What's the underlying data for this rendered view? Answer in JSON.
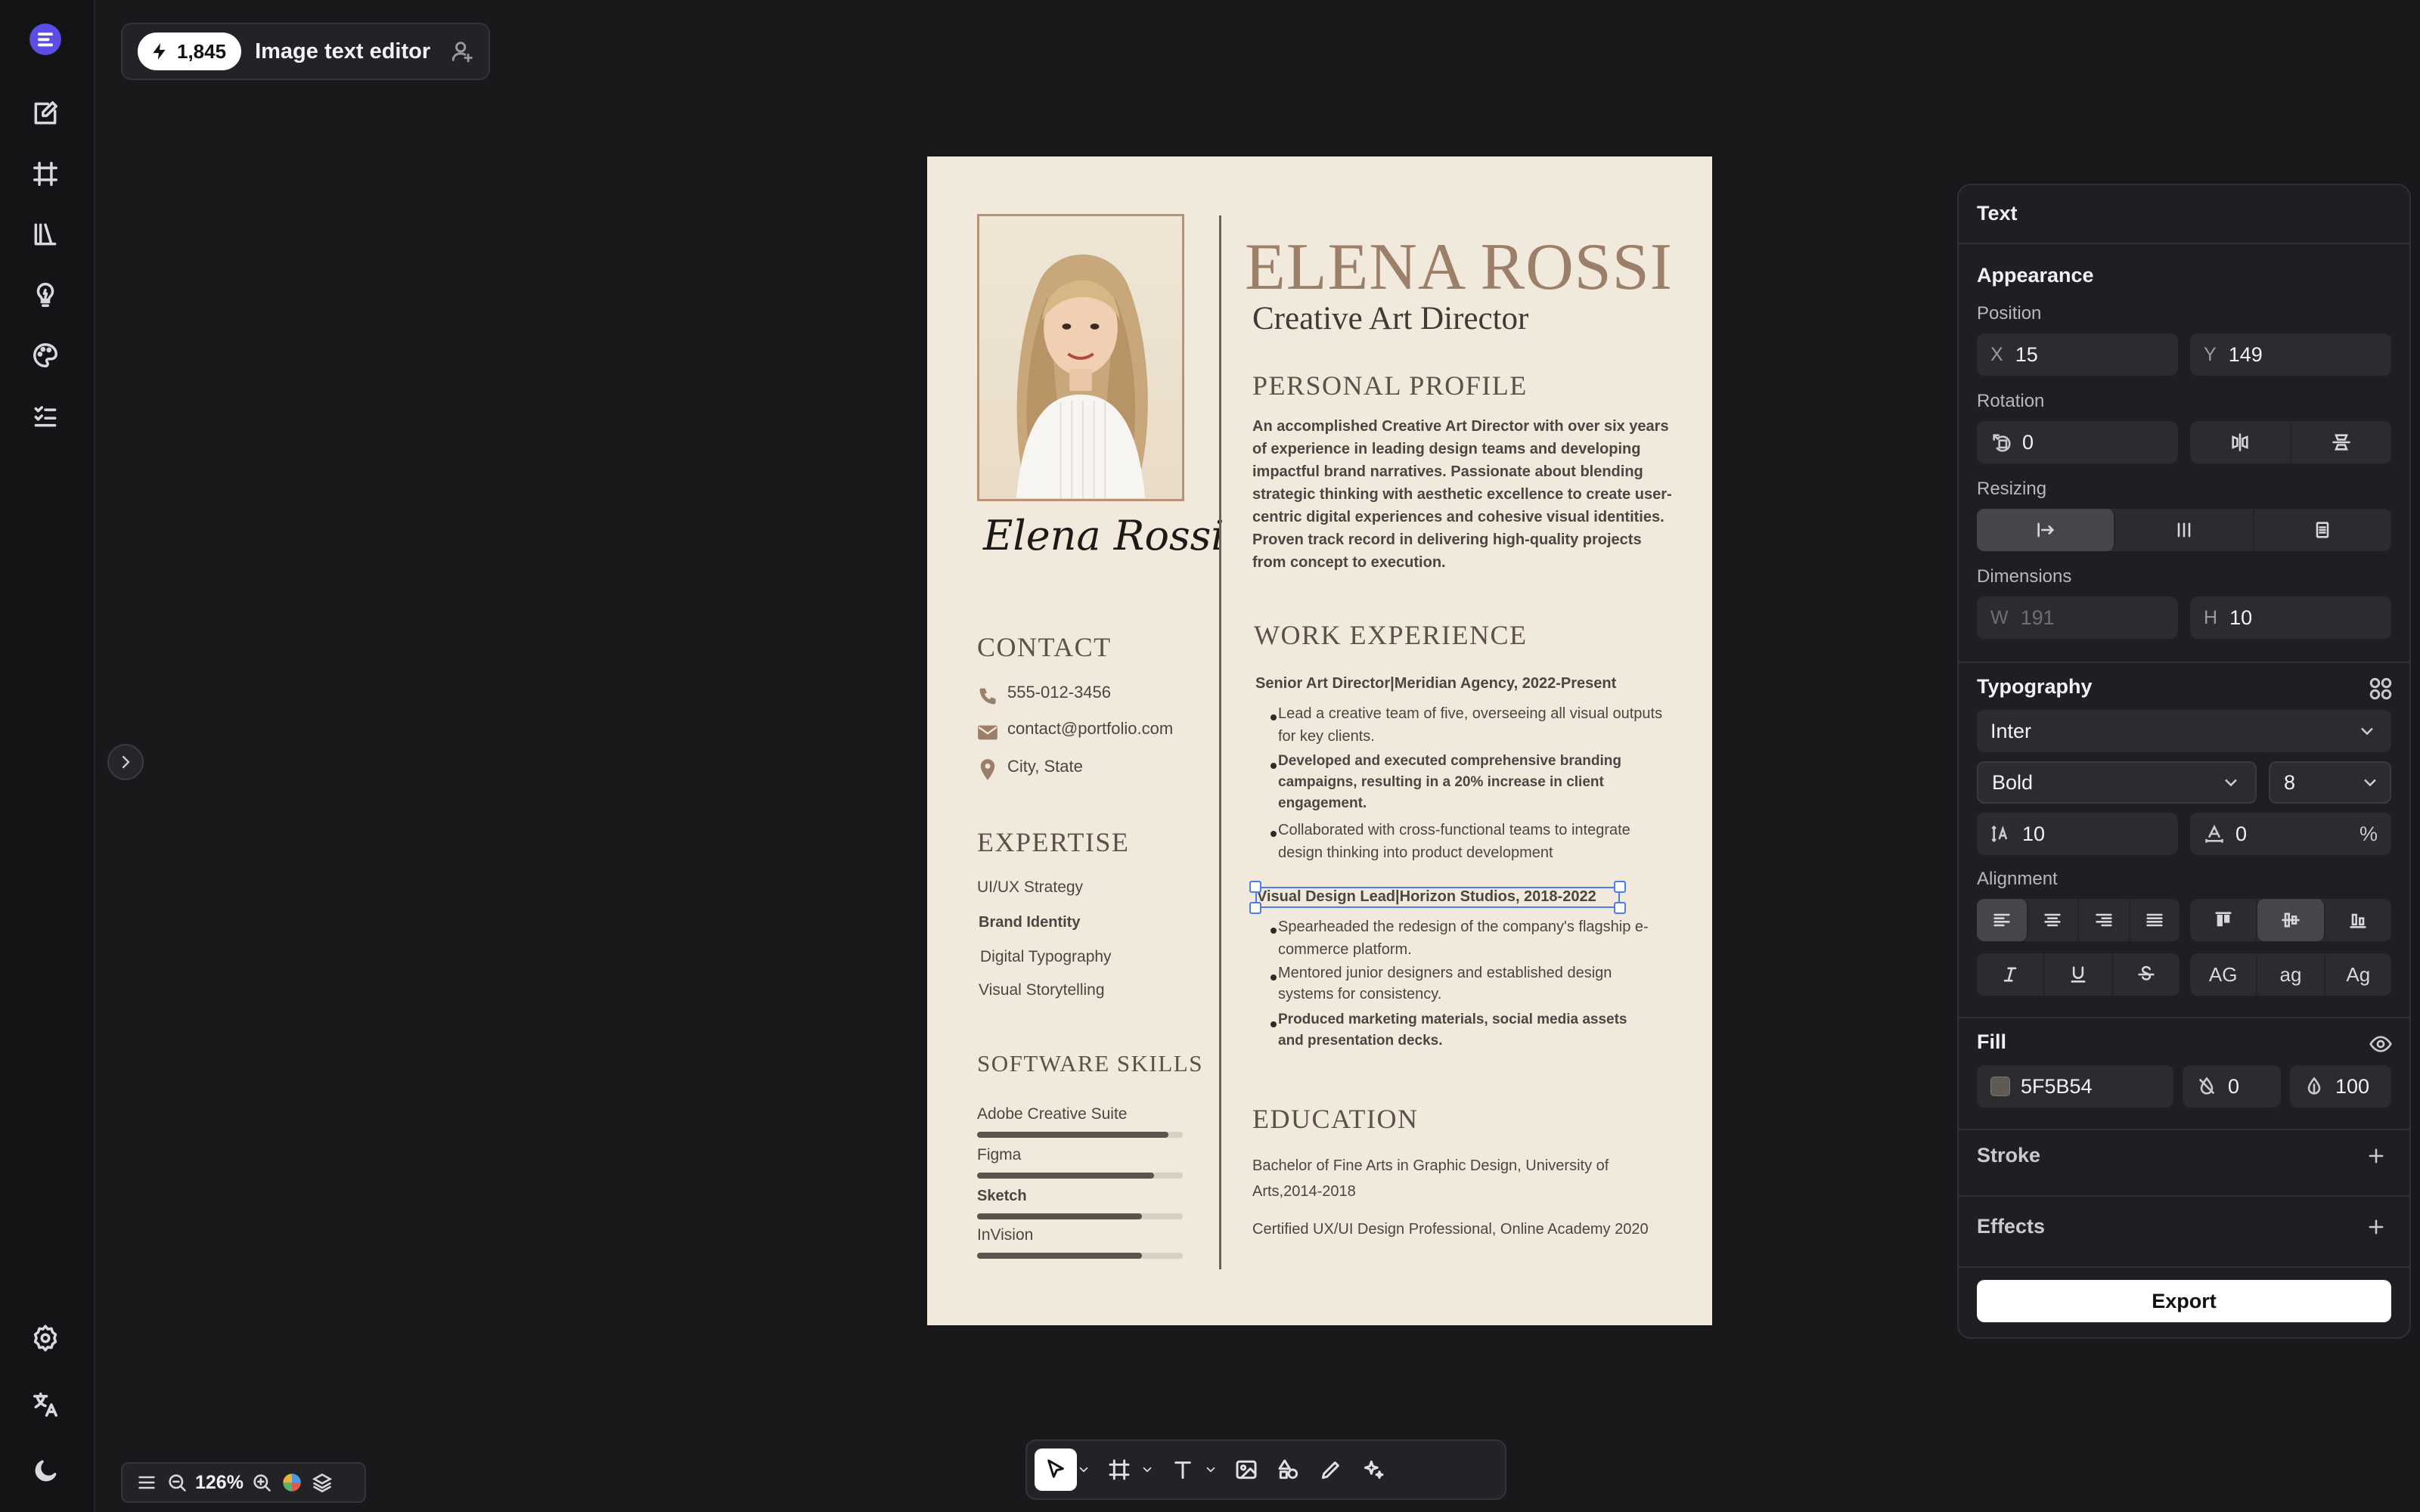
{
  "app": {
    "credits": "1,845",
    "title": "Image text editor",
    "zoom": "126%"
  },
  "doc": {
    "name": "ELENA ROSSI",
    "role": "Creative Art Director",
    "signature": "Elena Rossi",
    "profile_heading": "PERSONAL PROFILE",
    "profile_text": "An accomplished Creative Art Director with over six years of experience in leading design teams and developing impactful brand narratives. Passionate about blending strategic thinking with aesthetic excellence to create user-centric digital experiences and cohesive visual identities. Proven track record in delivering high-quality projects from concept to execution.",
    "contact_heading": "CONTACT",
    "phone": "555-012-3456",
    "email": "contact@portfolio.com",
    "location": "City, State",
    "expertise_heading": "EXPERTISE",
    "expertise": [
      "UI/UX Strategy",
      "Brand Identity",
      "Digital Typography",
      "Visual Storytelling"
    ],
    "software_heading": "SOFTWARE SKILLS",
    "software": [
      {
        "name": "Adobe Creative Suite",
        "level": 0.93
      },
      {
        "name": "Figma",
        "level": 0.86
      },
      {
        "name": "Sketch",
        "level": 0.8
      },
      {
        "name": "InVision",
        "level": 0.8
      }
    ],
    "work_heading": "WORK EXPERIENCE",
    "job1_title": "Senior Art Director|Meridian Agency, 2022-Present",
    "job1_b1": "Lead a creative team of five, overseeing all visual outputs for key clients.",
    "job1_b2": "Developed and executed comprehensive branding campaigns, resulting in a 20% increase in client engagement.",
    "job1_b3": "Collaborated with cross-functional teams to integrate design thinking into product development",
    "job2_title": "Visual Design Lead|Horizon Studios, 2018-2022",
    "job2_b1": "Spearheaded the redesign of the company's flagship e-commerce platform.",
    "job2_b2": "Mentored junior designers and established design systems for consistency.",
    "job2_b3": "Produced marketing materials, social media assets and presentation decks.",
    "education_heading": "EDUCATION",
    "edu1": "Bachelor of Fine Arts in Graphic Design, University of Arts,2014-2018",
    "edu2": "Certified UX/UI Design Professional, Online Academy 2020"
  },
  "panel": {
    "title": "Text",
    "appearance": "Appearance",
    "position_label": "Position",
    "x_prefix": "X",
    "x_value": "15",
    "y_prefix": "Y",
    "y_value": "149",
    "rotation_label": "Rotation",
    "rotation_value": "0",
    "resizing_label": "Resizing",
    "dimensions_label": "Dimensions",
    "w_prefix": "W",
    "w_value": "191",
    "h_prefix": "H",
    "h_value": "10",
    "typography": "Typography",
    "font_family": "Inter",
    "font_weight": "Bold",
    "font_size": "8",
    "line_height": "10",
    "letter_spacing": "0",
    "letter_spacing_unit": "%",
    "alignment_label": "Alignment",
    "case_upper": "AG",
    "case_lower": "ag",
    "case_title": "Ag",
    "fill": "Fill",
    "fill_hex": "5F5B54",
    "fill_color": "#5F5B54",
    "fill_value2": "0",
    "fill_opacity": "100",
    "stroke": "Stroke",
    "effects": "Effects",
    "export": "Export"
  }
}
